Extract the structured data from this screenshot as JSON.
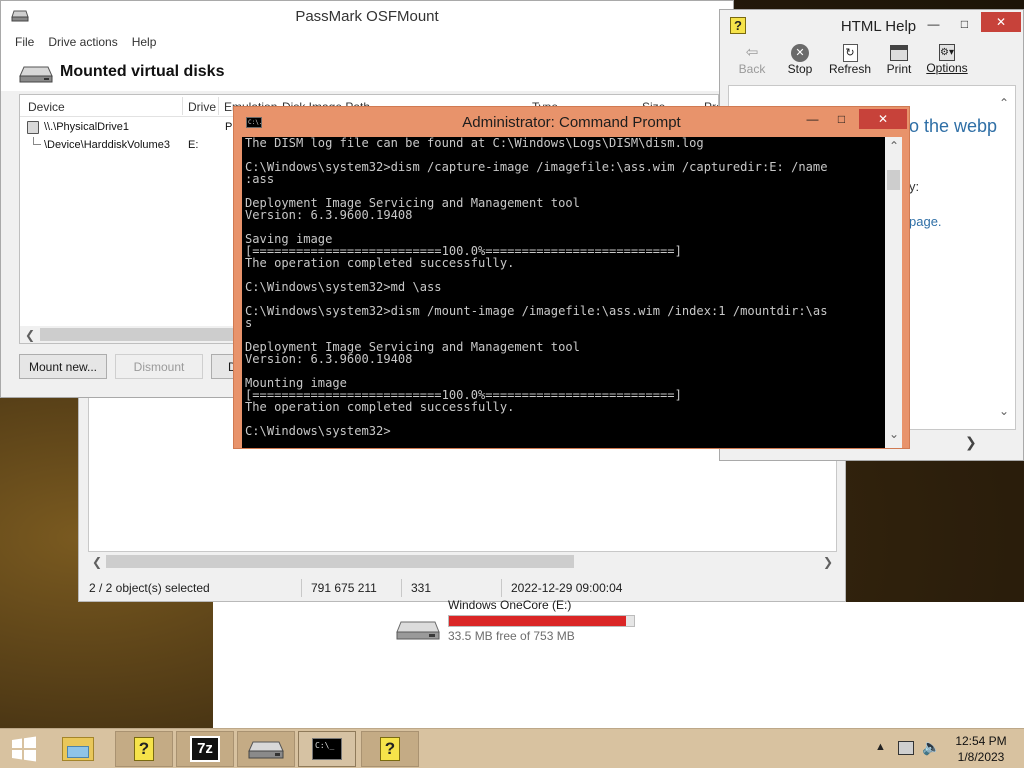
{
  "behind_window": {
    "status": {
      "selected": "2 / 2 object(s) selected",
      "size": "791 675 211",
      "count": "331",
      "date": "2022-12-29 09:00:04"
    }
  },
  "drive_item": {
    "name": "Windows OneCore (E:)",
    "free_text": "33.5 MB free of 753 MB",
    "used_fraction": 0.956,
    "bar_color": "#da2626"
  },
  "osfmount": {
    "title": "PassMark OSFMount",
    "menu": [
      "File",
      "Drive actions",
      "Help"
    ],
    "heading": "Mounted virtual disks",
    "columns": [
      "Device",
      "Drive",
      "Emulation",
      "Disk Image Path",
      "Type",
      "Size",
      "Pro"
    ],
    "rows": [
      {
        "device": "\\\\.\\PhysicalDrive1",
        "drive": "",
        "emulation": "Ph"
      },
      {
        "device": "\\Device\\HarddiskVolume3",
        "drive": "E:",
        "emulation": ""
      }
    ],
    "buttons": {
      "mount": "Mount new...",
      "dismount": "Dismount",
      "third": "D"
    }
  },
  "html_help": {
    "title": "HTML Help",
    "toolbar": [
      "Back",
      "Stop",
      "Refresh",
      "Print",
      "Options"
    ],
    "content_heading": "o the webp",
    "content_line1": "y:",
    "content_link": "page."
  },
  "cmd": {
    "title": "Administrator:  Command Prompt",
    "icon_text": "C:\\.",
    "lines": [
      "The DISM log file can be found at C:\\Windows\\Logs\\DISM\\dism.log",
      "",
      "C:\\Windows\\system32>dism /capture-image /imagefile:\\ass.wim /capturedir:E: /name",
      ":ass",
      "",
      "Deployment Image Servicing and Management tool",
      "Version: 6.3.9600.19408",
      "",
      "Saving image",
      "[==========================100.0%==========================]",
      "The operation completed successfully.",
      "",
      "C:\\Windows\\system32>md \\ass",
      "",
      "C:\\Windows\\system32>dism /mount-image /imagefile:\\ass.wim /index:1 /mountdir:\\as",
      "s",
      "",
      "Deployment Image Servicing and Management tool",
      "Version: 6.3.9600.19408",
      "",
      "Mounting image",
      "[==========================100.0%==========================]",
      "The operation completed successfully.",
      "",
      "C:\\Windows\\system32>"
    ]
  },
  "taskbar": {
    "items": [
      "start-icon",
      "file-explorer-icon",
      "help-icon",
      "7zip-icon",
      "osfmount-icon",
      "command-prompt-icon",
      "help-icon"
    ],
    "sevenzip_label": "7z",
    "time": "12:54 PM",
    "date": "1/8/2023"
  },
  "colors": {
    "cmd_frame": "#e8936b",
    "cmd_close": "#c7423a",
    "taskbar": "#d8c2a0"
  }
}
